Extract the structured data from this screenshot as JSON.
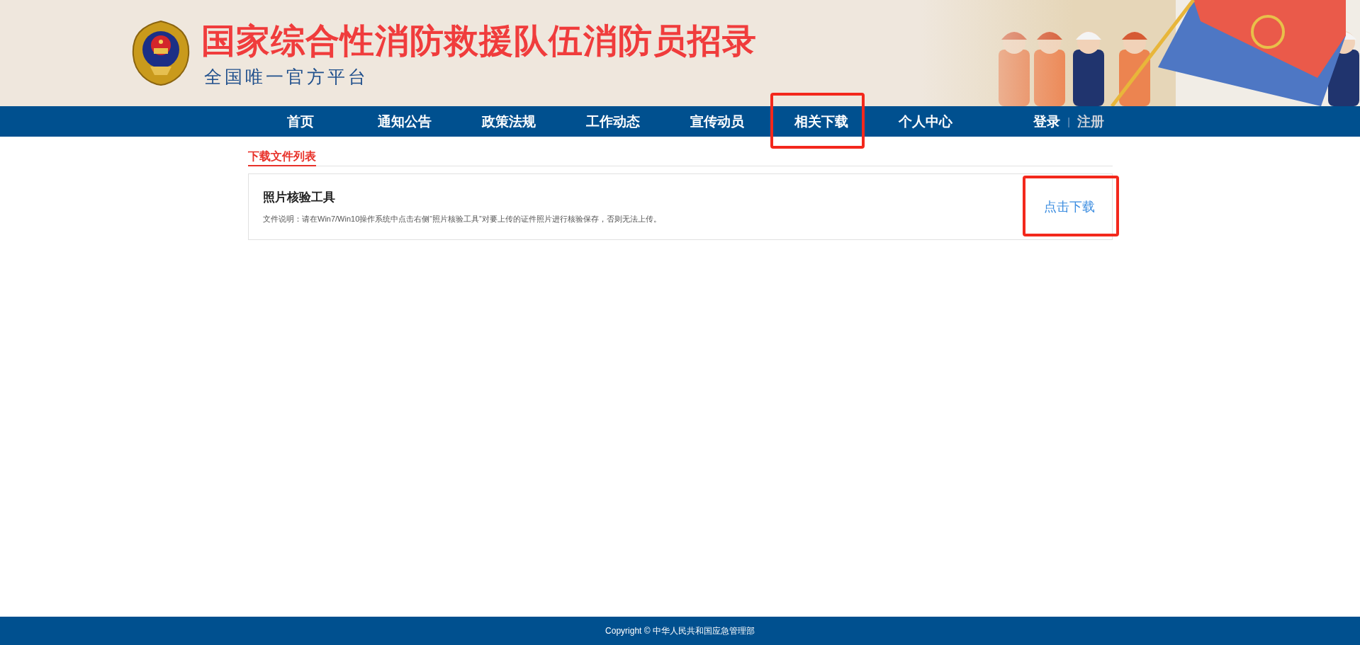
{
  "header": {
    "title": "国家综合性消防救援队伍消防员招录",
    "subtitle": "全国唯一官方平台"
  },
  "nav": {
    "items": [
      {
        "label": "首页",
        "highlighted": false
      },
      {
        "label": "通知公告",
        "highlighted": false
      },
      {
        "label": "政策法规",
        "highlighted": false
      },
      {
        "label": "工作动态",
        "highlighted": false
      },
      {
        "label": "宣传动员",
        "highlighted": false
      },
      {
        "label": "相关下载",
        "highlighted": true
      },
      {
        "label": "个人中心",
        "highlighted": false
      }
    ],
    "login": "登录",
    "separator": "|",
    "register": "注册"
  },
  "section_title": "下载文件列表",
  "files": [
    {
      "name": "照片核验工具",
      "description": "文件说明：请在Win7/Win10操作系统中点击右侧“照片核验工具”对要上传的证件照片进行核验保存，否则无法上传。",
      "action": "点击下载",
      "highlighted": true
    }
  ],
  "footer": "Copyright © 中华人民共和国应急管理部"
}
